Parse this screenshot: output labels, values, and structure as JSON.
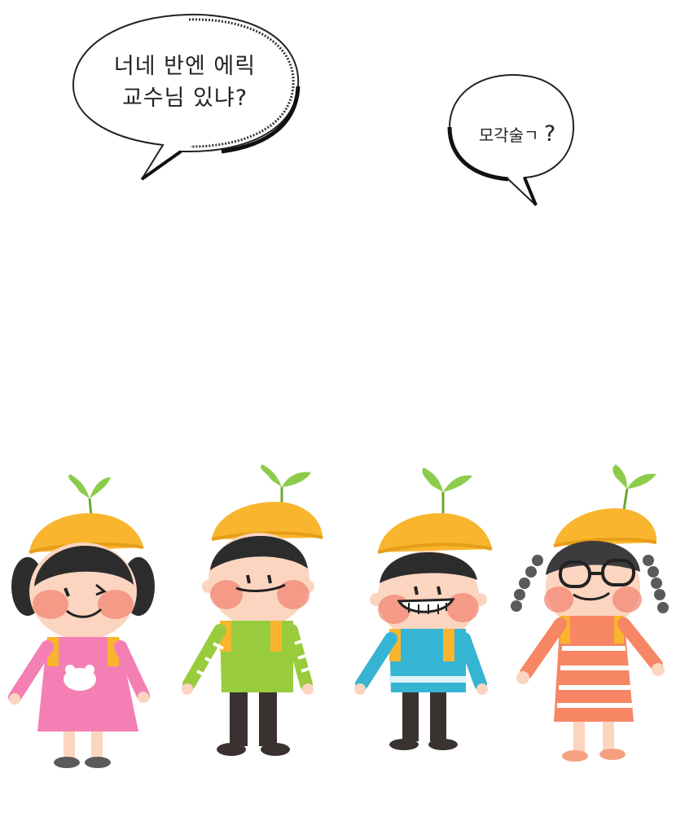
{
  "speech_bubbles": [
    {
      "line1": "너네 반엔 에릭",
      "line2": "교수님 있냐?"
    },
    {
      "text": "모각술ㄱ",
      "punct": "?"
    }
  ],
  "illustration": {
    "characters": [
      {
        "name": "pink-dress-girl",
        "shirt_color": "#f47fb4",
        "hair": "pigtails"
      },
      {
        "name": "green-shirt-boy",
        "shirt_color": "#98cc3c"
      },
      {
        "name": "blue-shirt-boy",
        "shirt_color": "#36b4d4"
      },
      {
        "name": "striped-dress-girl",
        "shirt_color": "#f78664",
        "hair": "braids"
      }
    ],
    "hat_color": "#f9b52e",
    "sprout_color": "#8ccc4a"
  }
}
